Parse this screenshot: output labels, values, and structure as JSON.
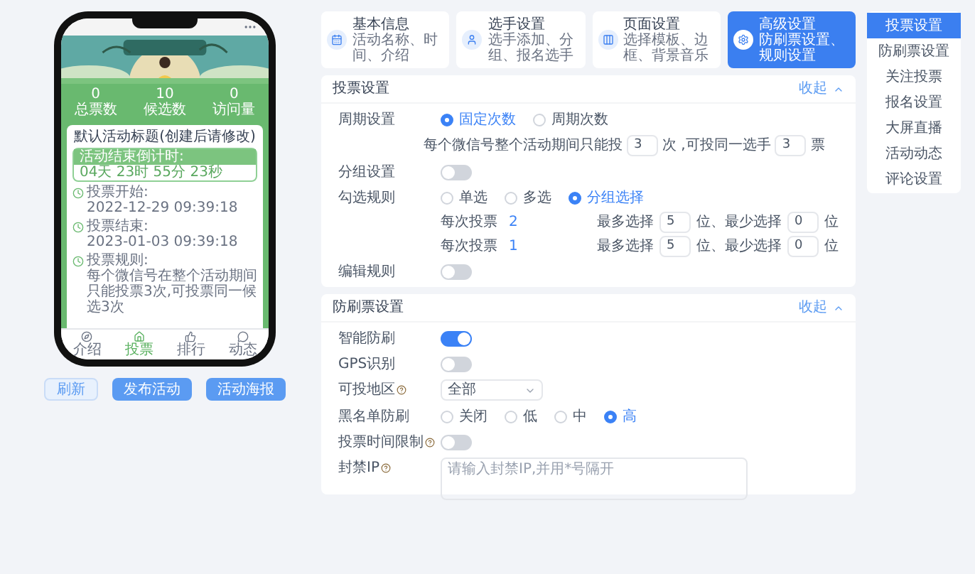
{
  "phone": {
    "stats": [
      {
        "value": "0",
        "label": "总票数"
      },
      {
        "value": "10",
        "label": "候选数"
      },
      {
        "value": "0",
        "label": "访问量"
      }
    ],
    "card_title": "默认活动标题(创建后请修改)",
    "countdown": {
      "label": "活动结束倒计时:",
      "time": "04天 23时 55分 23秒"
    },
    "info": [
      {
        "label": "投票开始:",
        "value": "2022-12-29 09:39:18"
      },
      {
        "label": "投票结束:",
        "value": "2023-01-03 09:39:18"
      },
      {
        "label": "投票规则:",
        "value": "每个微信号在整个活动期间只能投票3次,可投票同一候选3次"
      }
    ],
    "nav": [
      {
        "label": "介绍",
        "selected": false
      },
      {
        "label": "投票",
        "selected": true
      },
      {
        "label": "排行",
        "selected": false
      },
      {
        "label": "动态",
        "selected": false
      }
    ]
  },
  "actions": [
    {
      "label": "刷新",
      "kind": "secondary"
    },
    {
      "label": "发布活动",
      "kind": "primary"
    },
    {
      "label": "活动海报",
      "kind": "primary"
    }
  ],
  "steps": [
    {
      "title": "基本信息",
      "subtitle": "活动名称、时间、介绍",
      "selected": false
    },
    {
      "title": "选手设置",
      "subtitle": "选手添加、分组、报名选手",
      "selected": false
    },
    {
      "title": "页面设置",
      "subtitle": "选择模板、边框、背景音乐",
      "selected": false
    },
    {
      "title": "高级设置",
      "subtitle": "防刷票设置、规则设置",
      "selected": true
    }
  ],
  "side_menu": [
    {
      "label": "投票设置",
      "selected": true
    },
    {
      "label": "防刷票设置",
      "selected": false
    },
    {
      "label": "关注投票",
      "selected": false
    },
    {
      "label": "报名设置",
      "selected": false
    },
    {
      "label": "大屏直播",
      "selected": false
    },
    {
      "label": "活动动态",
      "selected": false
    },
    {
      "label": "评论设置",
      "selected": false
    }
  ],
  "sections": [
    {
      "title": "投票设置",
      "collapse": "收起",
      "rows": [
        {
          "kind": "radio",
          "label": "周期设置",
          "options": [
            {
              "label": "固定次数",
              "selected": true
            },
            {
              "label": "周期次数",
              "selected": false
            }
          ]
        },
        {
          "kind": "limit",
          "text1": "每个微信号整个活动期间只能投",
          "value1": "3",
          "text2": "次 ,可投同一选手",
          "value2": "3",
          "text3": "票"
        },
        {
          "kind": "toggle",
          "label": "分组设置",
          "on": false
        },
        {
          "kind": "radio",
          "label": "勾选规则",
          "options": [
            {
              "label": "单选",
              "selected": false
            },
            {
              "label": "多选",
              "selected": false
            },
            {
              "label": "分组选择",
              "selected": true
            }
          ]
        },
        {
          "kind": "group_limits",
          "items": [
            {
              "label": "每次投票",
              "count": "2",
              "max_label": "最多选择",
              "max": "5",
              "min_label": "位、最少选择",
              "min": "0",
              "unit": "位"
            },
            {
              "label": "每次投票",
              "count": "1",
              "max_label": "最多选择",
              "max": "5",
              "min_label": "位、最少选择",
              "min": "0",
              "unit": "位"
            }
          ]
        },
        {
          "kind": "toggle",
          "label": "编辑规则",
          "on": false
        }
      ]
    },
    {
      "title": "防刷票设置",
      "collapse": "收起",
      "rows": [
        {
          "kind": "toggle",
          "label": "智能防刷",
          "on": true
        },
        {
          "kind": "toggle",
          "label": "GPS识别",
          "on": false
        },
        {
          "kind": "select",
          "label": "可投地区",
          "help": true,
          "value": "全部"
        },
        {
          "kind": "radio",
          "label": "黑名单防刷",
          "options": [
            {
              "label": "关闭",
              "selected": false
            },
            {
              "label": "低",
              "selected": false
            },
            {
              "label": "中",
              "selected": false
            },
            {
              "label": "高",
              "selected": true
            }
          ]
        },
        {
          "kind": "toggle",
          "label": "投票时间限制",
          "help": true,
          "on": false
        },
        {
          "kind": "textarea",
          "label": "封禁IP",
          "help": true,
          "placeholder": "请输入封禁IP,并用*号隔开"
        }
      ]
    }
  ]
}
